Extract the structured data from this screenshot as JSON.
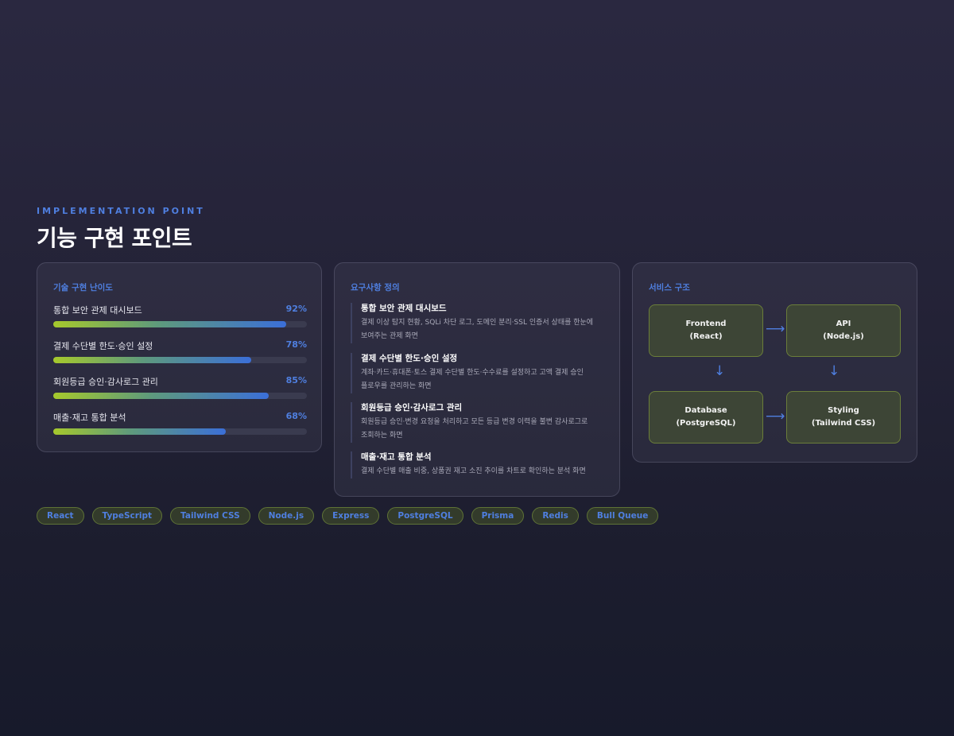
{
  "header": {
    "eyebrow": "IMPLEMENTATION POINT",
    "title": "기능 구현 포인트"
  },
  "difficulty": {
    "title": "기술 구현 난이도",
    "items": [
      {
        "label": "통합 보안 관제 대시보드",
        "percent_label": "92%",
        "percent": 92
      },
      {
        "label": "결제 수단별 한도·승인 설정",
        "percent_label": "78%",
        "percent": 78
      },
      {
        "label": "회원등급 승인·감사로그 관리",
        "percent_label": "85%",
        "percent": 85
      },
      {
        "label": "매출·재고 통합 분석",
        "percent_label": "68%",
        "percent": 68
      }
    ]
  },
  "requirements": {
    "title": "요구사항 정의",
    "items": [
      {
        "title": "통합 보안 관제 대시보드",
        "desc_1": "결제 이상 탐지 현황, SQLi 차단 로그, 도메인 분리·SSL 인증서 상태를 한눈에",
        "desc_2": "보여주는 관제 화면"
      },
      {
        "title": "결제 수단별 한도·승인 설정",
        "desc_1": "계좌·카드·휴대폰·토스 결제 수단별 한도·수수료를 설정하고 고액 결제 승인",
        "desc_2": "플로우를 관리하는 화면"
      },
      {
        "title": "회원등급 승인·감사로그 관리",
        "desc_1": "회원등급 승인·변경 요청을 처리하고 모든 등급 변경 이력을 불변 감사로그로",
        "desc_2": "조회하는 화면"
      },
      {
        "title": "매출·재고 통합 분석",
        "desc_1": "결제 수단별 매출 비중, 상품권 재고 소진 추이를 차트로 확인하는 분석 화면",
        "desc_2": ""
      }
    ]
  },
  "architecture": {
    "title": "서비스 구조",
    "nodes": {
      "frontend": {
        "line1": "Frontend",
        "line2": "(React)"
      },
      "api": {
        "line1": "API",
        "line2": "(Node.js)"
      },
      "database": {
        "line1": "Database",
        "line2": "(PostgreSQL)"
      },
      "styling": {
        "line1": "Styling",
        "line2": "(Tailwind CSS)"
      }
    },
    "arrow_right": "⟶",
    "arrow_down": "↓"
  },
  "tags": [
    "React",
    "TypeScript",
    "Tailwind CSS",
    "Node.js",
    "Express",
    "PostgreSQL",
    "Prisma",
    "Redis",
    "Bull Queue"
  ],
  "colors": {
    "accent": "#4f7fe0",
    "node_border": "#6b7e3a",
    "bar_start": "#a6c92c",
    "bar_end": "#3b6fd8"
  }
}
